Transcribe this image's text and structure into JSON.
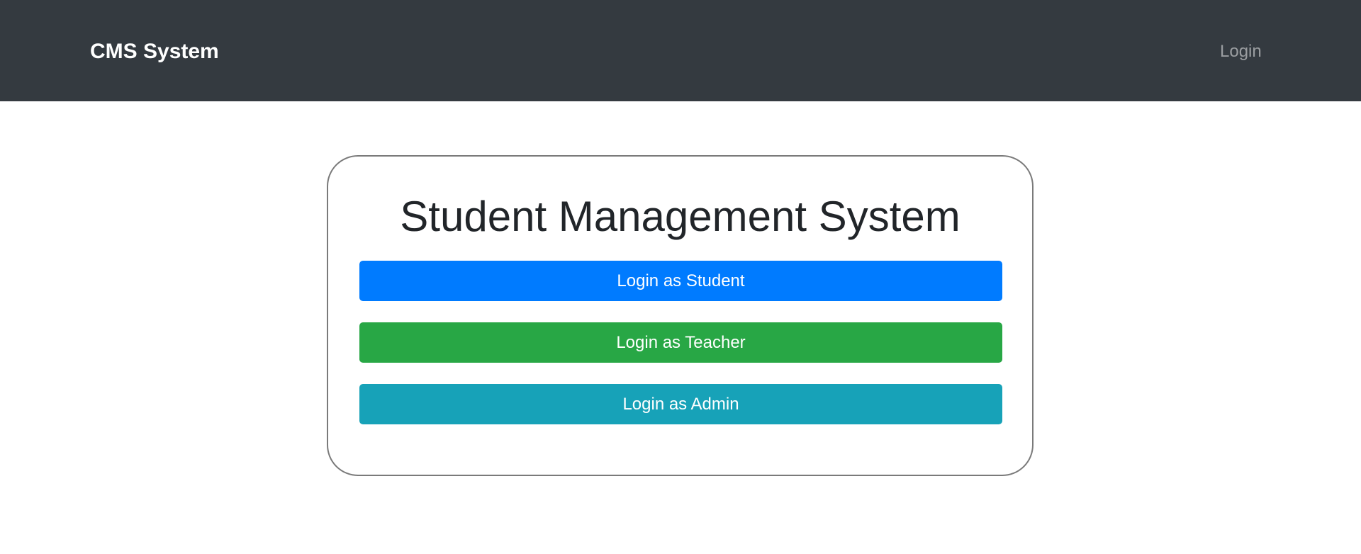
{
  "navbar": {
    "brand": "CMS System",
    "login_link": "Login"
  },
  "main": {
    "title": "Student Management System",
    "buttons": [
      {
        "label": "Login as Student",
        "color": "#007bff"
      },
      {
        "label": "Login as Teacher",
        "color": "#28a745"
      },
      {
        "label": "Login as Admin",
        "color": "#17a2b8"
      }
    ]
  },
  "colors": {
    "navbar_bg": "#343a40",
    "primary": "#007bff",
    "success": "#28a745",
    "info": "#17a2b8"
  }
}
